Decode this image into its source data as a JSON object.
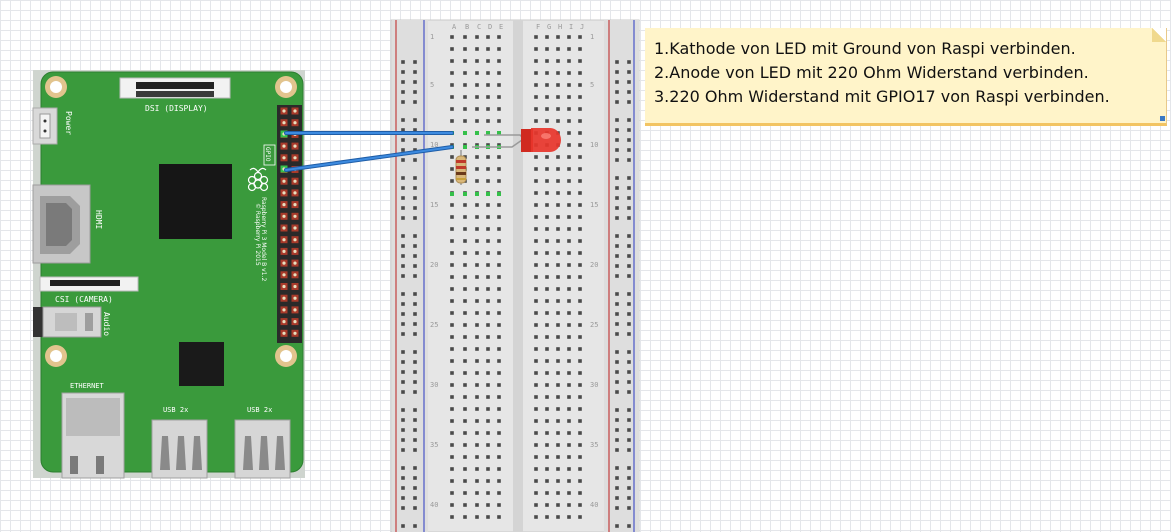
{
  "instructions": [
    "1.Kathode von LED mit Ground von Raspi verbinden.",
    "2.Anode von LED mit 220 Ohm Widerstand verbinden.",
    "3.220 Ohm Widerstand mit GPIO17 von Raspi verbinden."
  ],
  "raspberry_pi": {
    "dsi_label": "DSI (DISPLAY)",
    "csi_label": "CSI (CAMERA)",
    "power_label": "Power",
    "hdmi_label": "HDMI",
    "audio_label": "Audio",
    "ethernet_label": "ETHERNET",
    "usb_label": "USB 2x",
    "gpio_label": "GPIO",
    "model_label": "Raspberry Pi 3 Model B v1.2",
    "copyright_label": "© Raspberry Pi 2015"
  },
  "breadboard": {
    "column_letters_left": [
      "A",
      "B",
      "C",
      "D",
      "E"
    ],
    "column_letters_right": [
      "F",
      "G",
      "H",
      "I",
      "J"
    ],
    "row_numbers": [
      "1",
      "5",
      "10",
      "15",
      "20",
      "25",
      "30",
      "35",
      "40"
    ]
  },
  "colors": {
    "pcb_green": "#3a9a3c",
    "wire_blue": "#2d74c8",
    "led_red": "#e8352b",
    "note_yellow": "#fff4c9",
    "breadboard_body": "#e7e7e7"
  }
}
